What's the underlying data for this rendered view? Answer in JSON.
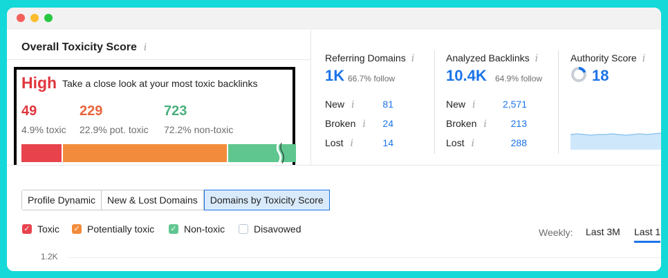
{
  "overall": {
    "title": "Overall Toxicity Score",
    "info": "i",
    "level": "High",
    "caption": "Take a close look at your most toxic backlinks",
    "toxic": {
      "count": "49",
      "label": "4.9% toxic",
      "share": 4.9
    },
    "potentially_toxic": {
      "count": "229",
      "label": "22.9% pot. toxic",
      "share": 22.9
    },
    "non_toxic": {
      "count": "723",
      "label": "72.2% non-toxic",
      "share": 72.2
    }
  },
  "referring_domains": {
    "title": "Referring Domains",
    "value": "1K",
    "follow": "66.7% follow",
    "rows": [
      {
        "label": "New",
        "value": "81"
      },
      {
        "label": "Broken",
        "value": "24"
      },
      {
        "label": "Lost",
        "value": "14"
      }
    ]
  },
  "analyzed_backlinks": {
    "title": "Analyzed Backlinks",
    "value": "10.4K",
    "follow": "64.9% follow",
    "rows": [
      {
        "label": "New",
        "value": "2,571"
      },
      {
        "label": "Broken",
        "value": "213"
      },
      {
        "label": "Lost",
        "value": "288"
      }
    ]
  },
  "authority": {
    "title": "Authority Score",
    "value": "18"
  },
  "tabs": [
    "Profile Dynamic",
    "New & Lost Domains",
    "Domains by Toxicity Score"
  ],
  "legend": [
    "Toxic",
    "Potentially toxic",
    "Non-toxic",
    "Disavowed"
  ],
  "period": {
    "label": "Weekly:",
    "options": [
      "Last 3M",
      "Last 1"
    ]
  },
  "chart": {
    "y_tick": "1.2K"
  },
  "colors": {
    "toxic": "#e8434d",
    "potentially_toxic": "#f28c3c",
    "non_toxic": "#5fc690",
    "accent": "#1b73e8"
  }
}
